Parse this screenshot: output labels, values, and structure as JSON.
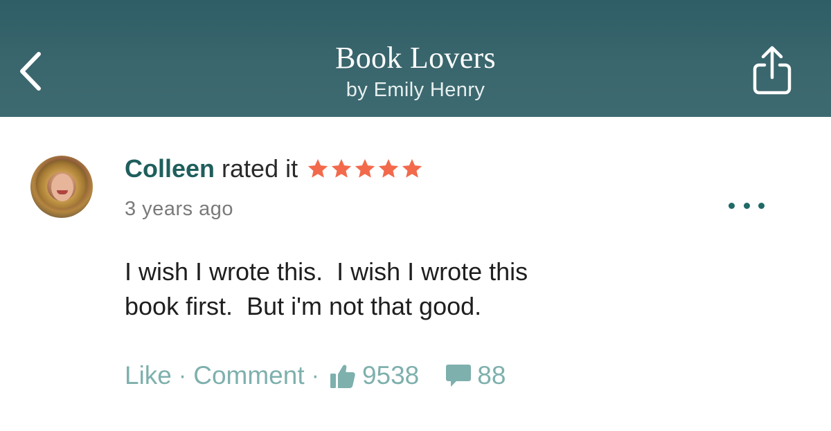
{
  "header": {
    "title": "Book Lovers",
    "subtitle": "by Emily Henry",
    "back_icon": "chevron-left-icon",
    "share_icon": "share-icon",
    "background": "#3a666d"
  },
  "review": {
    "user_name": "Colleen",
    "rated_text": "rated it",
    "rating": 5,
    "rating_max": 5,
    "star_color": "#f26a4b",
    "timestamp": "3 years ago",
    "body": "I wish I wrote this.  I wish I wrote this\nbook first.  But i'm not that good.",
    "more_icon": "more-options-icon"
  },
  "actions": {
    "like_label": "Like",
    "separator": "·",
    "comment_label": "Comment",
    "likes_count": "9538",
    "comments_count": "88",
    "accent": "#7eb0ad"
  }
}
